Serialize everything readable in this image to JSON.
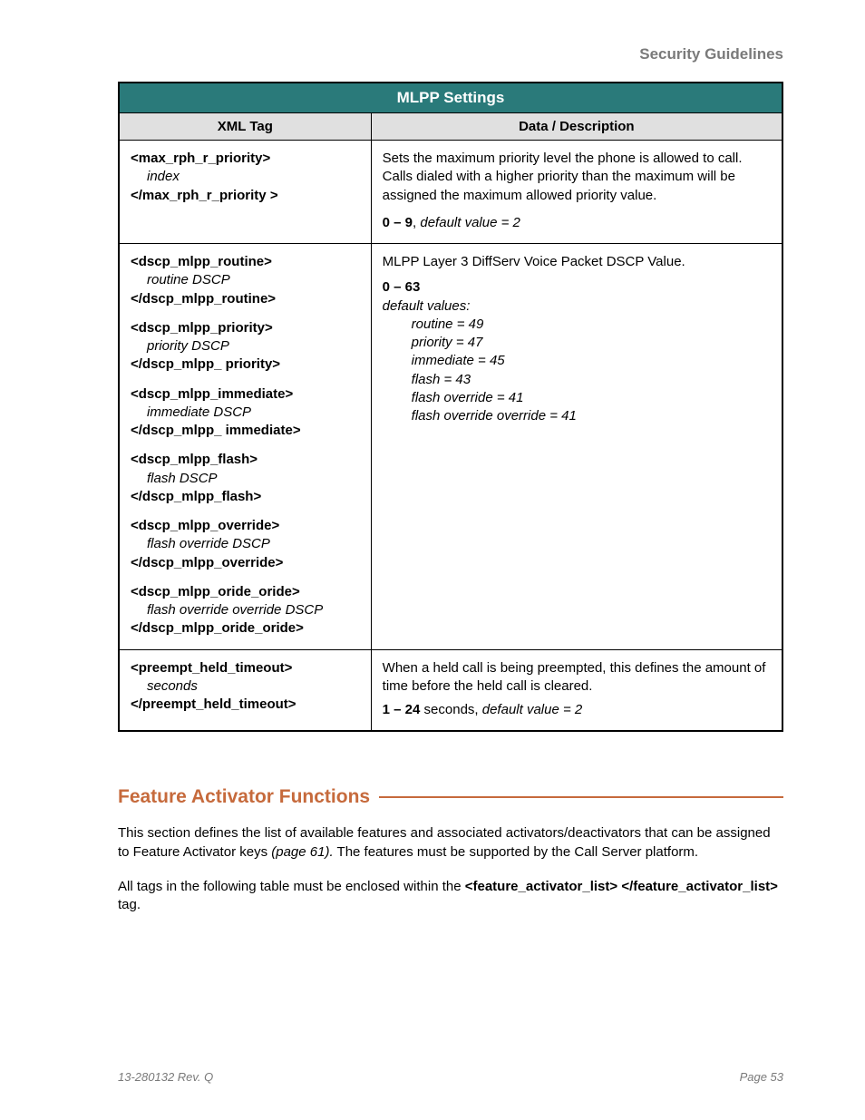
{
  "header": {
    "title": "Security Guidelines"
  },
  "table": {
    "title": "MLPP Settings",
    "col1": "XML Tag",
    "col2": "Data / Description",
    "rows": [
      {
        "tag_open": "<max_rph_r_priority>",
        "tag_value": "index",
        "tag_close": "</max_rph_r_priority >",
        "desc1": "Sets the maximum priority level the phone is allowed to call.  Calls dialed with a higher priority than the maximum will be assigned the maximum allowed priority value.",
        "range_bold": "0 – 9",
        "range_sep": ",  ",
        "range_def": "default value = 2"
      },
      {
        "group": [
          {
            "open": "<dscp_mlpp_routine>",
            "val": "routine DSCP",
            "close": "</dscp_mlpp_routine>"
          },
          {
            "open": "<dscp_mlpp_priority>",
            "val": "priority DSCP",
            "close": "</dscp_mlpp_ priority>"
          },
          {
            "open": "<dscp_mlpp_immediate>",
            "val": "immediate DSCP",
            "close": "</dscp_mlpp_ immediate>"
          },
          {
            "open": "<dscp_mlpp_flash>",
            "val": "flash DSCP",
            "close": "</dscp_mlpp_flash>"
          },
          {
            "open": "<dscp_mlpp_override>",
            "val": "flash override DSCP",
            "close": "</dscp_mlpp_override>"
          },
          {
            "open": "<dscp_mlpp_oride_oride>",
            "val": "flash override override DSCP",
            "close": "</dscp_mlpp_oride_oride>"
          }
        ],
        "desc_head": "MLPP Layer 3 DiffServ Voice Packet DSCP Value.",
        "range_bold": "0 – 63",
        "defaults_label": "default values:",
        "defaults": [
          "routine = 49",
          "priority = 47",
          "immediate = 45",
          "flash = 43",
          "flash override = 41",
          "flash override override = 41"
        ]
      },
      {
        "tag_open": "<preempt_held_timeout>",
        "tag_value": "seconds",
        "tag_close": "</preempt_held_timeout>",
        "desc1": "When a held call is being preempted, this defines the amount of time before the held call is cleared.",
        "range_bold": "1 – 24",
        "range_mid": " seconds,  ",
        "range_def": "default value = 2"
      }
    ]
  },
  "section": {
    "title": "Feature Activator Functions",
    "para1a": "This section defines the list of available features and associated activators/deactivators that can be assigned to Feature Activator keys ",
    "para1b": "(page 61).",
    "para1c": " The features must be supported by the Call Server platform.",
    "para2a": "All tags in the following table must be enclosed within the ",
    "para2b": "<feature_activator_list> </feature_activator_list>",
    "para2c": " tag."
  },
  "footer": {
    "left": "13-280132  Rev. Q",
    "right": "Page 53"
  }
}
